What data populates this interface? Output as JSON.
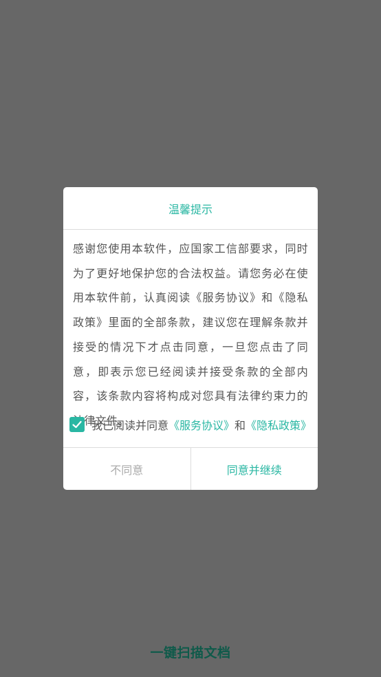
{
  "background": {
    "app_title": "一键扫描文档"
  },
  "dialog": {
    "title": "温馨提示",
    "body": "感谢您使用本软件，应国家工信部要求，同时为了更好地保护您的合法权益。请您务必在使用本软件前，认真阅读《服务协议》和《隐私政策》里面的全部条款，建议您在理解条款并接受的情况下才点击同意，一旦您点击了同意，即表示您已经阅读并接受条款的全部内容，该条款内容将构成对您具有法律约束力的法律文件。",
    "agreement": {
      "checked": true,
      "prefix": "我已阅读并同意",
      "service_link": "《服务协议》",
      "connector": "和",
      "privacy_link": "《隐私政策》"
    },
    "buttons": {
      "disagree": "不同意",
      "agree": "同意并继续"
    }
  },
  "colors": {
    "accent": "#2ab7a3",
    "overlay": "#676767",
    "app_title": "#0f5a4a",
    "disabled_text": "#aaaaaa"
  }
}
